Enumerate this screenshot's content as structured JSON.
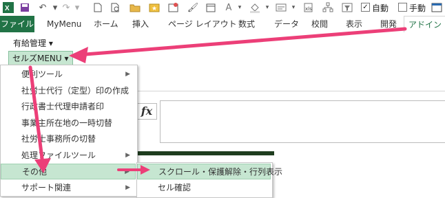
{
  "qat": {
    "icons": [
      "excel-icon",
      "save-icon",
      "undo-icon",
      "redo-icon",
      "new-icon",
      "print-preview-icon",
      "open-icon",
      "star-icon",
      "image-icon",
      "format-painter-icon",
      "font-color-icon",
      "fill-icon",
      "form-icon",
      "xml-icon",
      "layout-icon",
      "filter-icon"
    ],
    "auto_label": "自動",
    "manual_label": "手動"
  },
  "tabs": {
    "file": "ファイル",
    "items": [
      "MyMenu",
      "ホーム",
      "挿入",
      "ページ レイアウト",
      "数式",
      "データ",
      "校閲",
      "表示",
      "開発",
      "アドイン"
    ]
  },
  "ribbon": {
    "paid_leave": "有給管理 ▾",
    "cells_menu": "セルズMENU ▾"
  },
  "formula": {
    "fx": "fx"
  },
  "menu1": {
    "items": [
      {
        "label": "便利ツール",
        "submenu": true
      },
      {
        "label": "社労士代行（定型）印の作成",
        "submenu": false
      },
      {
        "label": "行政書士代理申請者印",
        "submenu": false
      },
      {
        "label": "事業主所在地の一時切替",
        "submenu": false
      },
      {
        "label": "社労士事務所の切替",
        "submenu": false
      },
      {
        "label": "処理ファイルツール",
        "submenu": true
      },
      {
        "label": "その他",
        "submenu": true
      },
      {
        "label": "サポート関連",
        "submenu": true
      }
    ]
  },
  "menu2": {
    "items": [
      "スクロール・保護解除・行列表示",
      "セル確認"
    ]
  },
  "colors": {
    "accent": "#217346",
    "highlight": "#c6e6d1",
    "arrow": "#ec3f78"
  }
}
